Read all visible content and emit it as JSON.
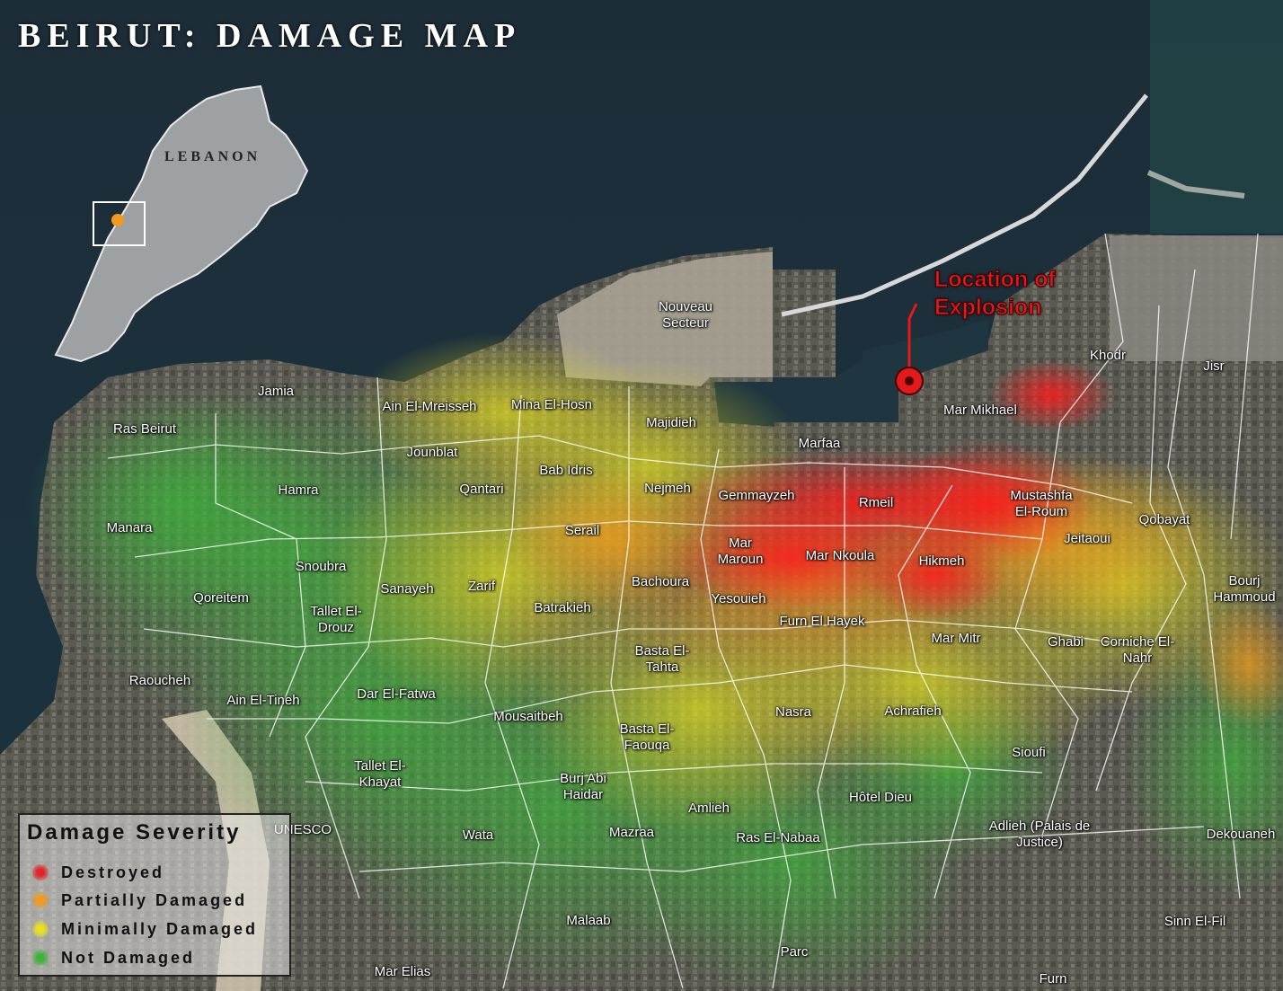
{
  "title": "BEIRUT: DAMAGE MAP",
  "inset": {
    "country_label": "LEBANON"
  },
  "explosion": {
    "label_line1": "Location of",
    "label_line2": "Explosion",
    "color": "#e31a1c"
  },
  "legend": {
    "title": "Damage Severity",
    "items": [
      {
        "label": "Destroyed",
        "color": "#e0242a"
      },
      {
        "label": "Partially Damaged",
        "color": "#f29a1f"
      },
      {
        "label": "Minimally Damaged",
        "color": "#e6e21c"
      },
      {
        "label": "Not Damaged",
        "color": "#3fb23a"
      }
    ]
  },
  "neighborhoods": [
    "Jamia",
    "Ain El-Mreisseh",
    "Ras Beirut",
    "Hamra",
    "Manara",
    "Snoubra",
    "Qoreitem",
    "Tallet El-Drouz",
    "Raoucheh",
    "Ain El-Tineh",
    "Jounblat",
    "Mina El-Hosn",
    "Bab Idris",
    "Qantari",
    "Sanayeh",
    "Zarif",
    "Dar El-Fatwa",
    "Majidieh",
    "Nejmeh",
    "Serail",
    "Batrakieh",
    "Bachoura",
    "Nouveau Secteur",
    "Gemmayzeh",
    "Marfaa",
    "Rmeil",
    "Mar Mikhael",
    "Khodr",
    "Jisr",
    "Mustashfa El-Roum",
    "Qobayat",
    "Jeitaoui",
    "Mar Maroun",
    "Mar Nkoula",
    "Hikmeh",
    "Yesouieh",
    "Furn El Hayek",
    "Mar Mitr",
    "Ghabi",
    "Corniche El-Nahr",
    "Bourj Hammoud",
    "Basta El-Tahta",
    "Mousaitbeh",
    "Basta El-Faouqa",
    "Nasra",
    "Achrafieh",
    "Sioufi",
    "Tallet El-Khayat",
    "Burj Abi Haidar",
    "Amlieh",
    "Hôtel Dieu",
    "Wata",
    "UNESCO",
    "Mazraa",
    "Ras El-Nabaa",
    "Adlieh (Palais de Justice)",
    "Dekouaneh",
    "Sinn El-Fil",
    "Malaab",
    "Parc",
    "Mar Elias",
    "Furn"
  ]
}
